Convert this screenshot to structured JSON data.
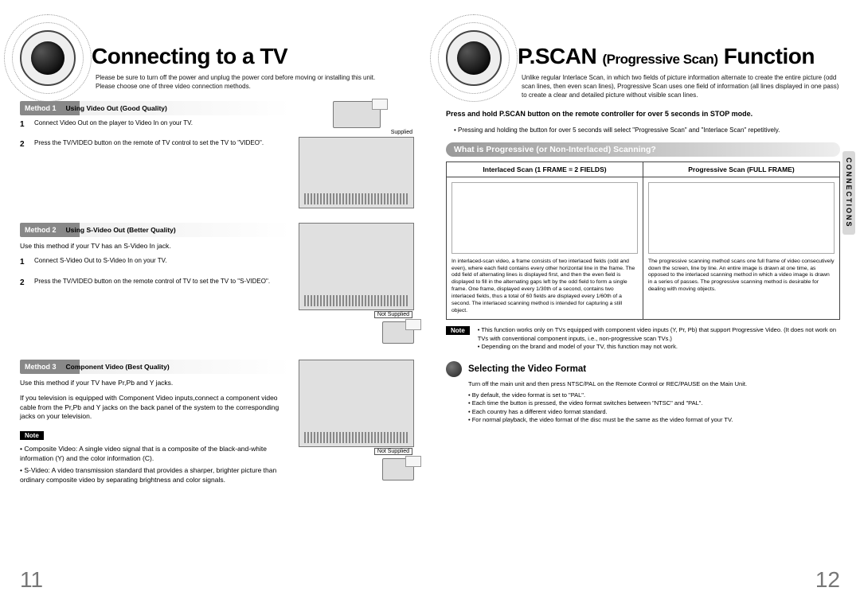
{
  "left": {
    "title": "Connecting to a TV",
    "intro1": "Please be sure to turn off the power and unplug the power cord before moving or installing this unit.",
    "intro2": "Please choose one of three video connection methods.",
    "pagenum": "11",
    "method1": {
      "tag": "Method 1",
      "label": "Using Video Out  (Good Quality)",
      "fig_caption": "Supplied",
      "step1_num": "1",
      "step1": "Connect Video Out on the player to Video In on your TV.",
      "step2_num": "2",
      "step2": "Press the TV/VIDEO button on the remote of TV control to set the TV to \"VIDEO\"."
    },
    "method2": {
      "tag": "Method 2",
      "label": "Using S-Video Out  (Better Quality)",
      "fig_caption": "Not Supplied",
      "sub": "Use this method if your TV has an S-Video In jack.",
      "step1_num": "1",
      "step1": "Connect S-Video Out to S-Video In on your TV.",
      "step2_num": "2",
      "step2": "Press the TV/VIDEO button on the remote control of TV to set the TV to \"S-VIDEO\"."
    },
    "method3": {
      "tag": "Method 3",
      "label": "Component Video (Best Quality)",
      "fig_caption": "Not Supplied",
      "sub": "Use this method if your TV have Pr,Pb and Y jacks.",
      "desc": "If you television is equipped with Component Video inputs,connect a component video cable from the Pr,Pb and Y jacks on the back panel of the system to the corresponding jacks on your television."
    },
    "note_label": "Note",
    "note1": "• Composite Video: A single video signal that is a composite of the black-and-white information (Y) and the color information (C).",
    "note2": "• S-Video: A video transmission standard that provides a sharper, brighter picture than ordinary composite video by separating brightness and color signals."
  },
  "right": {
    "title_a": "P.SCAN",
    "title_paren": "(Progressive Scan)",
    "title_b": "Function",
    "intro": "Unlike regular Interlace Scan, in which two fields of picture information alternate to create the entire picture (odd scan lines, then even scan lines), Progressive Scan uses one field of information (all lines displayed in one pass) to create a clear and detailed picture without visible scan lines.",
    "pagenum": "12",
    "instr_bold": "Press and hold P.SCAN button on the remote controller for over 5 seconds in STOP  mode.",
    "instr_bullet": "Pressing and holding the button for over 5 seconds will select \"Progressive Scan\" and \"Interlace Scan\" repetitively.",
    "section1": "What is Progressive (or Non-Interlaced) Scanning?",
    "th1": "Interlaced Scan (1 FRAME = 2 FIELDS)",
    "th2": "Progressive Scan (FULL FRAME)",
    "desc1": "In interlaced-scan video, a frame consists of two interlaced fields (odd and even), where each field contains every other horizontal line in the frame. The odd field of alternating lines is displayed first, and then the even field is displayed to fill in the alternating gaps left by the odd field to form a single frame. One frame, displayed every 1/30th of a second, contains two interlaced fields, thus a total of 60 fields are displayed every 1/60th of a second. The interlaced scanning method is intended for capturing a still object.",
    "desc2": "The progressive scanning method scans one full frame of video consecutively down the screen, line by line. An entire image is drawn at one time, as opposed to the interlaced scanning method in which a video image is drawn in a series of passes. The progressive scanning method is desirable for dealing with moving objects.",
    "note_label": "Note",
    "note_b1": "This function works only on TVs equipped with component video inputs (Y, Pr, Pb) that support Progressive Video. (It does not work on TVs with conventional component inputs, i.e., non-progressive scan TVs.)",
    "note_b2": "Depending on the brand and model of your TV, this function may not work.",
    "sel_header": "Selecting the Video Format",
    "sel_instr": "Turn off the main unit and then press NTSC/PAL on the Remote Control or REC/PAUSE on the Main Unit.",
    "sel_b1": "By default, the video format is set to \"PAL\".",
    "sel_b2": "Each time the button is pressed, the video format switches between \"NTSC\" and \"PAL\".",
    "sel_b3": "Each country has a different video format standard.",
    "sel_b4": "For normal playback, the video format of the disc must be the same as the video format of your TV.",
    "sidetab": "CONNECTIONS"
  }
}
